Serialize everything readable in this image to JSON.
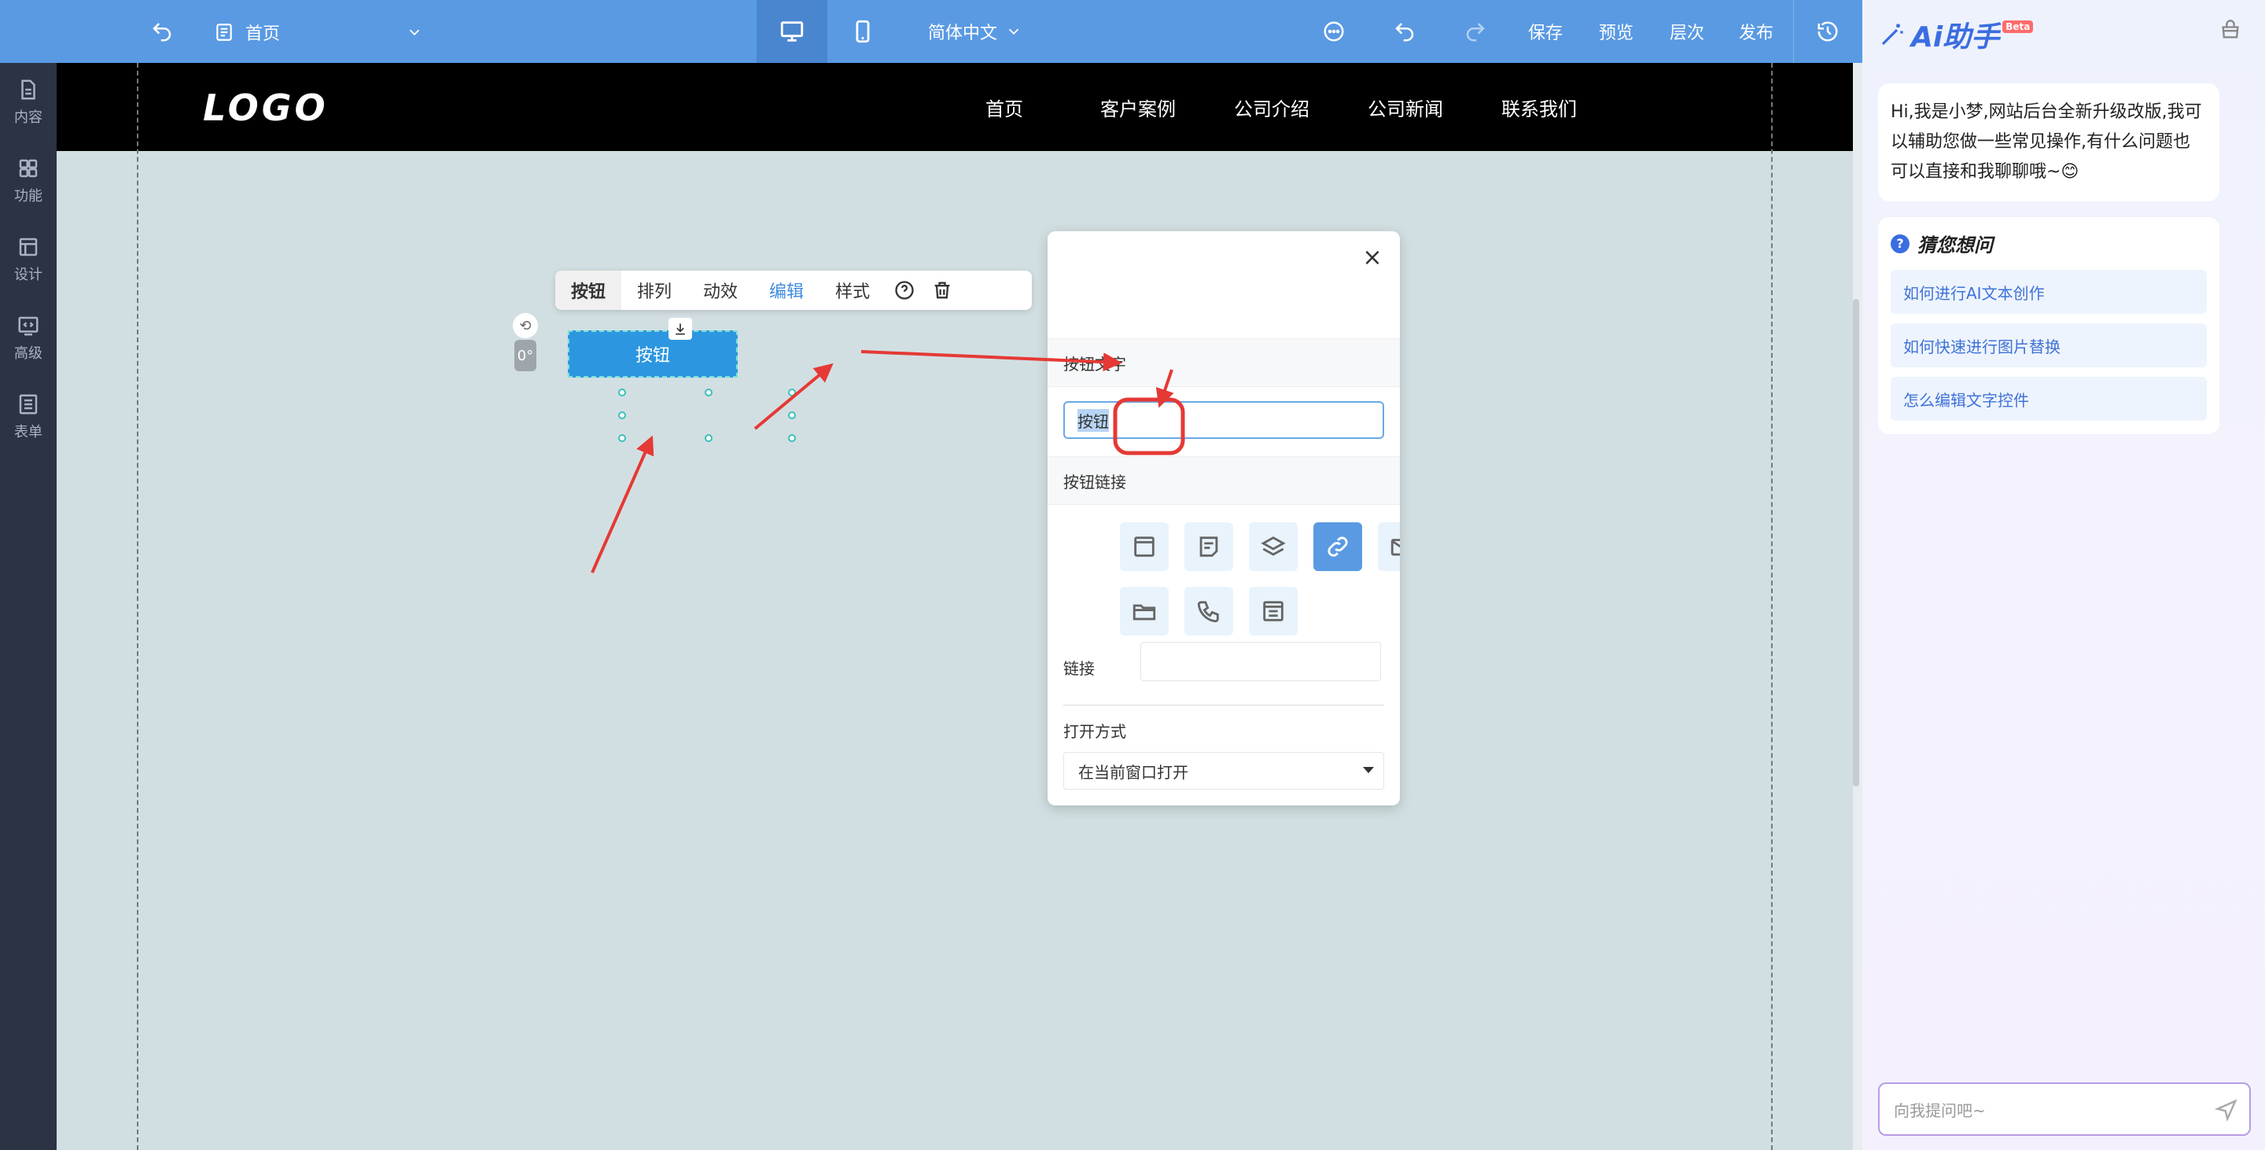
{
  "topbar": {
    "page": "首页",
    "language": "简体中文",
    "save": "保存",
    "preview": "预览",
    "layers": "层次",
    "publish": "发布"
  },
  "sidebar": {
    "items": [
      {
        "label": "内容",
        "icon": "document-icon"
      },
      {
        "label": "功能",
        "icon": "grid-icon"
      },
      {
        "label": "设计",
        "icon": "layout-icon"
      },
      {
        "label": "高级",
        "icon": "code-icon"
      },
      {
        "label": "表单",
        "icon": "form-icon"
      }
    ]
  },
  "site": {
    "logo": "LOGO",
    "nav": [
      "首页",
      "客户案例",
      "公司介绍",
      "公司新闻",
      "联系我们"
    ]
  },
  "element_toolbar": {
    "tools": [
      "按钮",
      "排列",
      "动效",
      "编辑",
      "样式"
    ],
    "active": "编辑"
  },
  "selected_button": {
    "label": "按钮",
    "rotation": "0°"
  },
  "edit_panel": {
    "button_text_label": "按钮文字",
    "button_text_value": "按钮",
    "button_link_label": "按钮链接",
    "link_label": "链接",
    "open_mode_label": "打开方式",
    "open_mode_value": "在当前窗口打开",
    "link_types": [
      "page-icon",
      "article-icon",
      "layers-icon",
      "link-icon",
      "mail-icon",
      "folder-icon",
      "phone-icon",
      "list-icon"
    ],
    "active_link_type": "link-icon"
  },
  "ai": {
    "title": "Ai助手",
    "badge": "Beta",
    "greeting": "Hi,我是小梦,网站后台全新升级改版,我可以辅助您做一些常见操作,有什么问题也可以直接和我聊聊哦~😊",
    "suggest_title": "猜您想问",
    "suggestions": [
      "如何进行AI文本创作",
      "如何快速进行图片替换",
      "怎么编辑文字控件"
    ],
    "input_placeholder": "向我提问吧~"
  },
  "colors": {
    "topbar": "#5a9ae3",
    "sidebar": "#2b3345",
    "canvas": "#d2dfe2",
    "accent": "#3f8be0",
    "arrow": "#e53935"
  }
}
